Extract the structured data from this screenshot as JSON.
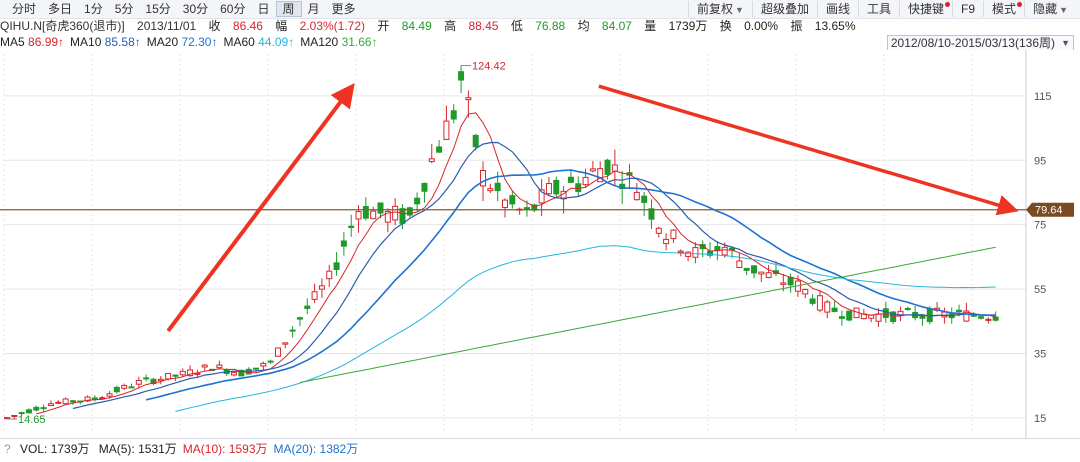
{
  "toolbar": {
    "periods": [
      "分时",
      "多日",
      "1分",
      "5分",
      "15分",
      "30分",
      "60分",
      "日",
      "周",
      "月",
      "更多"
    ],
    "active_period": "周",
    "tools": [
      {
        "label": "前复权",
        "chev": true,
        "dot": false
      },
      {
        "label": "超级叠加",
        "chev": false,
        "dot": false
      },
      {
        "label": "画线",
        "chev": false,
        "dot": false
      },
      {
        "label": "工具",
        "chev": false,
        "dot": false
      },
      {
        "label": "快捷键",
        "chev": false,
        "dot": true
      },
      {
        "label": "F9",
        "chev": false,
        "dot": false
      },
      {
        "label": "模式",
        "chev": false,
        "dot": true
      },
      {
        "label": "隐藏",
        "chev": true,
        "dot": false
      }
    ]
  },
  "info": {
    "symbol": "QIHU.N[奇虎360(退市)]",
    "date": "2013/11/01",
    "close_label": "收",
    "close": "86.46",
    "change_label": "幅",
    "change": "2.03%(1.72)",
    "open_label": "开",
    "open": "84.49",
    "high_label": "高",
    "high": "88.45",
    "low_label": "低",
    "low": "76.88",
    "avg_label": "均",
    "avg": "84.07",
    "vol_label": "量",
    "vol": "1739万",
    "turnover_label": "换",
    "turnover": "0.00%",
    "amp_label": "振",
    "amp": "13.65%"
  },
  "ma_legend": [
    {
      "name": "MA5",
      "value": "86.99↑",
      "color": "#d9262c"
    },
    {
      "name": "MA10",
      "value": "85.58↑",
      "color": "#2a5db0"
    },
    {
      "name": "MA20",
      "value": "72.30↑",
      "color": "#1e72d2"
    },
    {
      "name": "MA60",
      "value": "44.09↑",
      "color": "#27b4e0"
    },
    {
      "name": "MA120",
      "value": "31.66↑",
      "color": "#3aa83a"
    }
  ],
  "range_label": "2012/08/10-2015/03/13(136周)",
  "colors": {
    "up": "#d9262c",
    "down": "#1f9a2a",
    "ma5": "#d9262c",
    "ma10": "#2a5db0",
    "ma20": "#1e72d2",
    "ma60": "#27b4e0",
    "ma120": "#3aa83a",
    "hline": "#8a5a2b",
    "hline_tag": "#7a4a20",
    "arrow": "#ee3322",
    "grid": "#e6e6e6"
  },
  "chart_data": {
    "type": "candlestick",
    "period": "weekly",
    "y_ticks": [
      15,
      35,
      55,
      75,
      95,
      115
    ],
    "ylim": [
      10,
      128
    ],
    "candle_count": 136,
    "marked_high": {
      "value": 124.42,
      "label": "124.42",
      "index": 62
    },
    "marked_low": {
      "value": 14.65,
      "label": "14.65",
      "index": 0
    },
    "horizontal_line": {
      "value": 79.64,
      "label": "79.64"
    },
    "ohlc_anchors": [
      [
        0,
        15.0
      ],
      [
        6,
        19.5
      ],
      [
        12,
        21.0
      ],
      [
        18,
        26.0
      ],
      [
        24,
        28.5
      ],
      [
        28,
        31.0
      ],
      [
        32,
        29.0
      ],
      [
        36,
        32.0
      ],
      [
        40,
        46.0
      ],
      [
        44,
        58.0
      ],
      [
        48,
        80.0
      ],
      [
        52,
        78.0
      ],
      [
        55,
        77.5
      ],
      [
        58,
        95.0
      ],
      [
        61,
        110.0
      ],
      [
        62,
        120.0
      ],
      [
        65,
        90.0
      ],
      [
        68,
        82.0
      ],
      [
        71,
        78.0
      ],
      [
        74,
        85.0
      ],
      [
        78,
        88.0
      ],
      [
        82,
        94.0
      ],
      [
        86,
        86.5
      ],
      [
        90,
        72.0
      ],
      [
        94,
        66.0
      ],
      [
        98,
        68.0
      ],
      [
        101,
        62.0
      ],
      [
        104,
        59.0
      ],
      [
        108,
        56.0
      ],
      [
        112,
        49.0
      ],
      [
        116,
        47.0
      ]
    ],
    "ma_last": {
      "MA5": 86.99,
      "MA10": 85.58,
      "MA20": 72.3,
      "MA60": 44.09,
      "MA120": 31.66
    }
  },
  "volume": {
    "label": "VOL: 1739万",
    "items": [
      {
        "text": "MA(5): 1531万",
        "color": "#222222"
      },
      {
        "text": "MA(10): 1593万",
        "color": "#d9262c"
      },
      {
        "text": "MA(20): 1382万",
        "color": "#1e72d2"
      }
    ]
  }
}
